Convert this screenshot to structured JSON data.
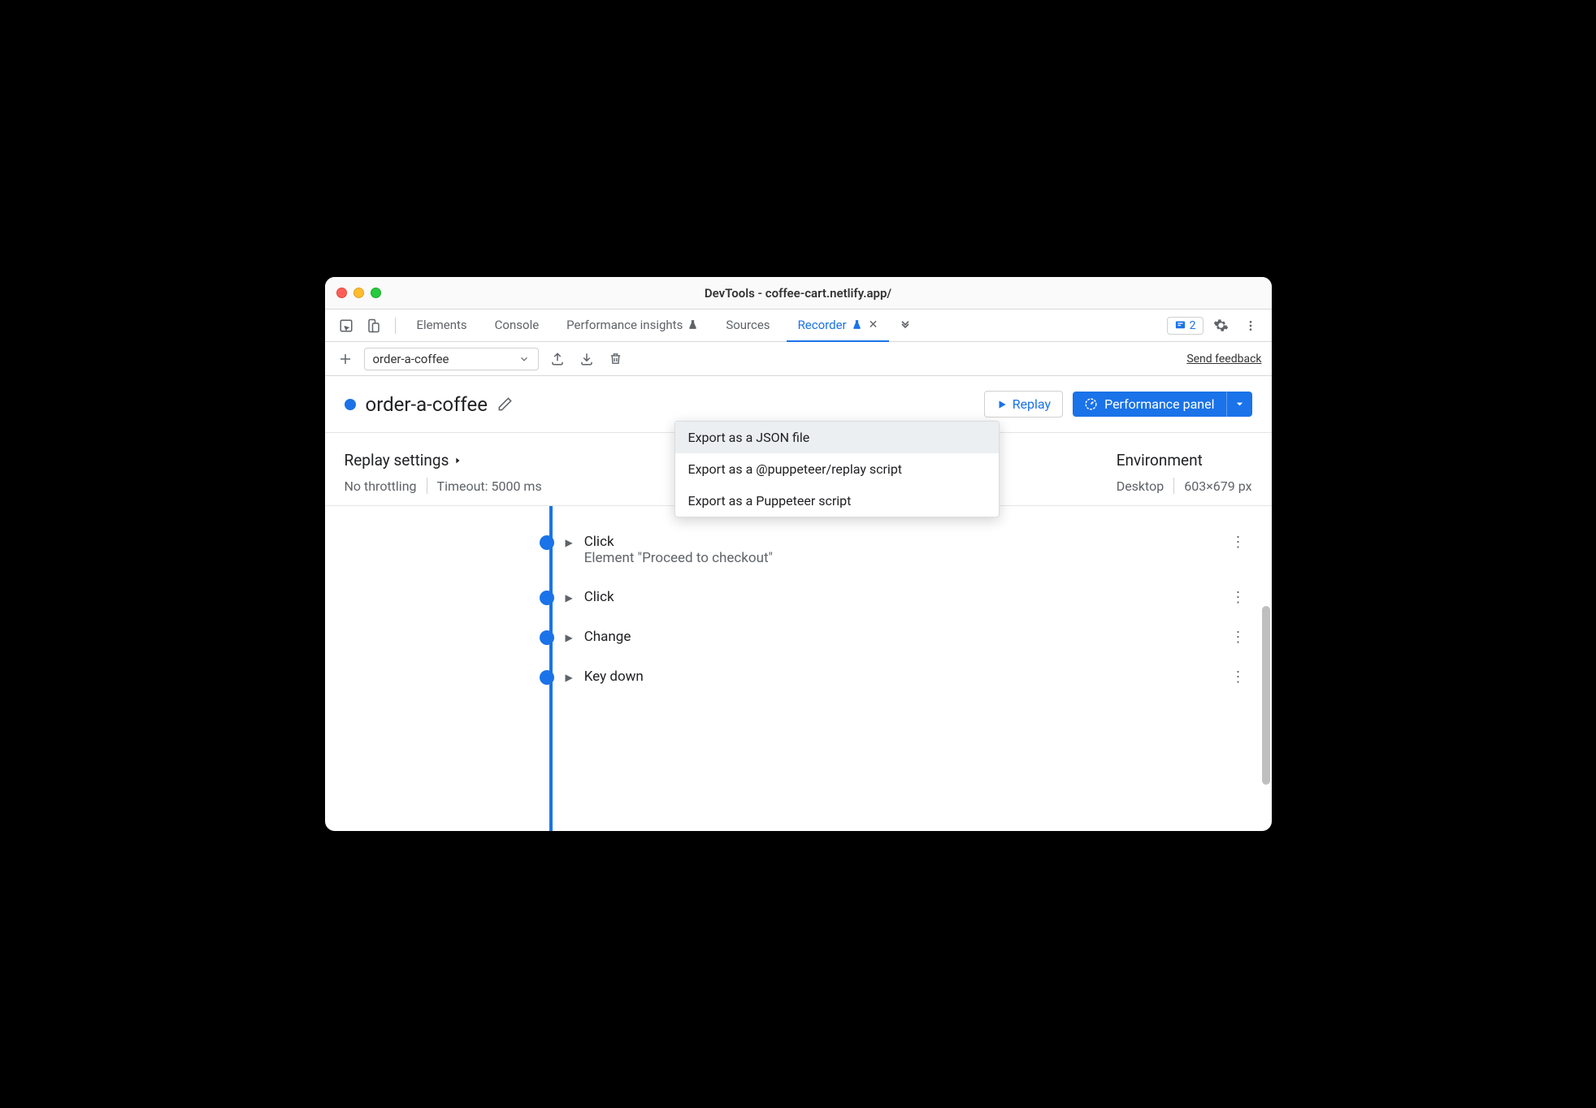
{
  "window": {
    "title": "DevTools - coffee-cart.netlify.app/"
  },
  "tabs": {
    "items": [
      {
        "label": "Elements"
      },
      {
        "label": "Console"
      },
      {
        "label": "Performance insights"
      },
      {
        "label": "Sources"
      },
      {
        "label": "Recorder"
      }
    ],
    "issues_count": "2"
  },
  "recorder_toolbar": {
    "recording_name": "order-a-coffee",
    "send_feedback": "Send feedback"
  },
  "export_menu": {
    "items": [
      "Export as a JSON file",
      "Export as a @puppeteer/replay script",
      "Export as a Puppeteer script"
    ]
  },
  "recording": {
    "title": "order-a-coffee",
    "replay_label": "Replay",
    "perf_label": "Performance panel"
  },
  "settings": {
    "replay_title": "Replay settings",
    "throttling": "No throttling",
    "timeout": "Timeout: 5000 ms",
    "env_title": "Environment",
    "device": "Desktop",
    "viewport": "603×679 px"
  },
  "steps": [
    {
      "label": "Click",
      "detail": "Element \"Proceed to checkout\""
    },
    {
      "label": "Click",
      "detail": ""
    },
    {
      "label": "Change",
      "detail": ""
    },
    {
      "label": "Key down",
      "detail": ""
    }
  ]
}
